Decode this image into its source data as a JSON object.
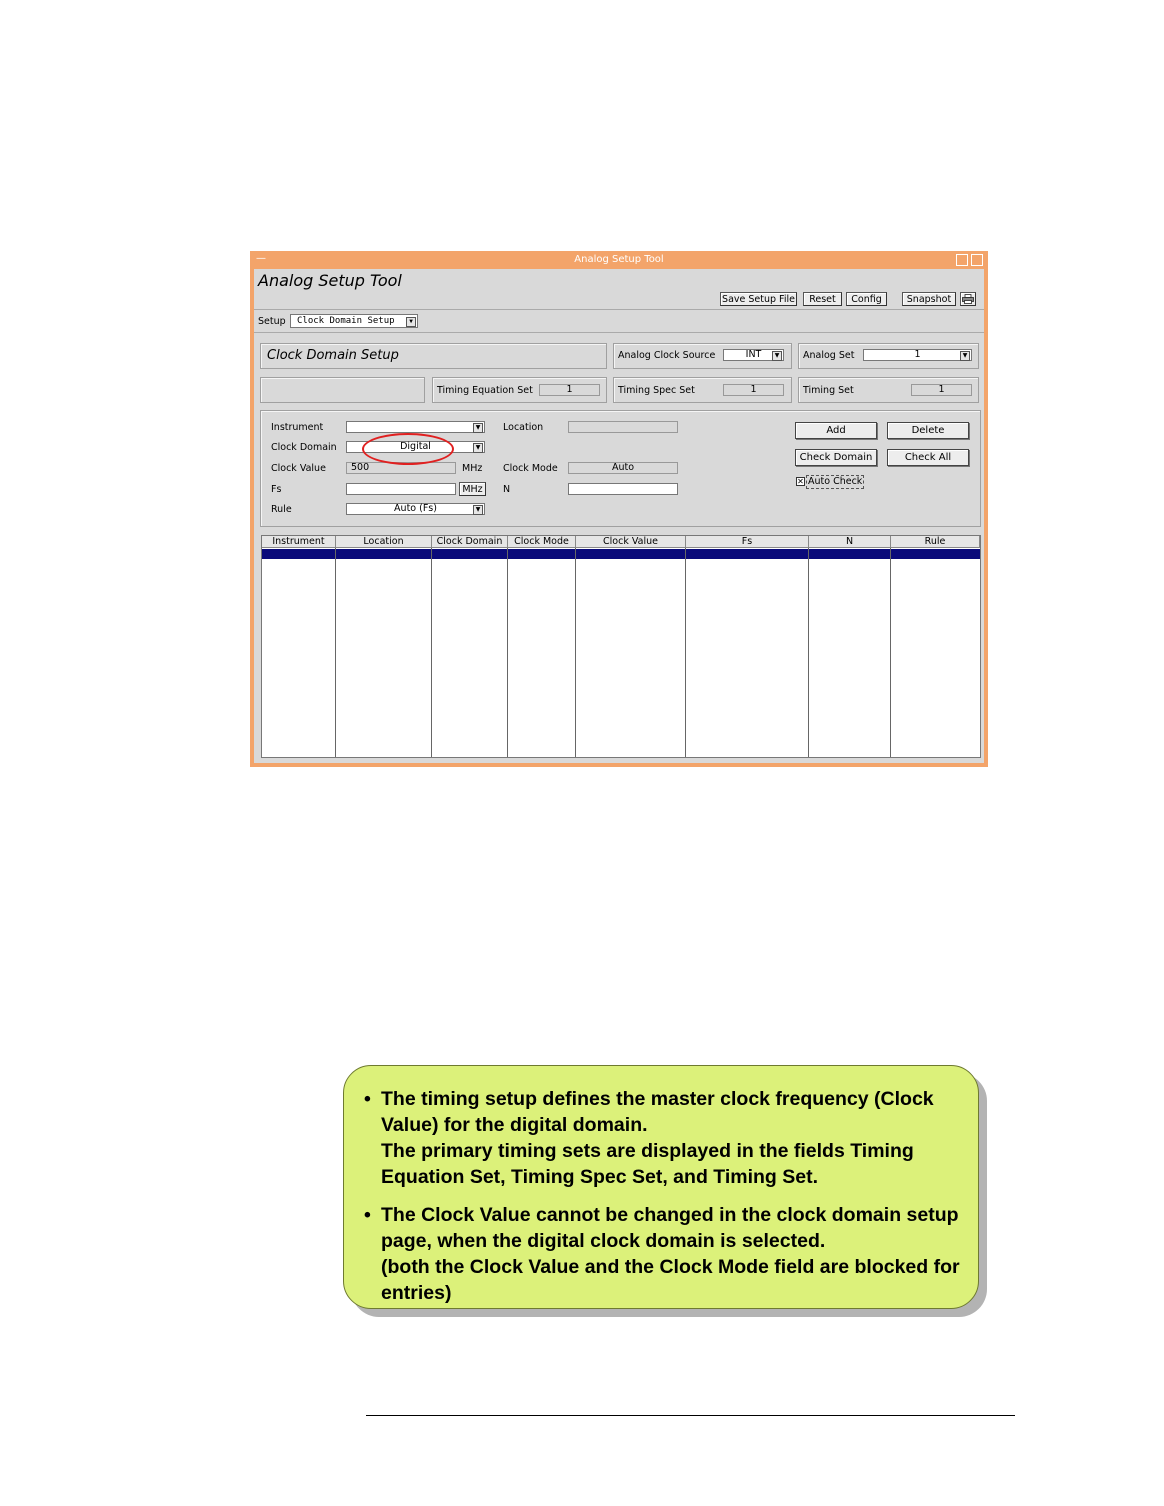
{
  "window": {
    "title": "Analog Setup Tool",
    "app_title": "Analog Setup Tool",
    "menu_glyph": "—"
  },
  "toolbar": {
    "save": "Save Setup File",
    "reset": "Reset",
    "config": "Config",
    "snapshot": "Snapshot",
    "print_icon": "printer-icon"
  },
  "setup": {
    "label": "Setup",
    "value": "Clock Domain Setup"
  },
  "header": {
    "panel_title": "Clock Domain Setup",
    "analog_clock_source_label": "Analog Clock Source",
    "analog_clock_source_value": "INT",
    "analog_set_label": "Analog Set",
    "analog_set_value": "1",
    "timing_equation_set_label": "Timing Equation Set",
    "timing_equation_set_value": "1",
    "timing_spec_set_label": "Timing Spec Set",
    "timing_spec_set_value": "1",
    "timing_set_label": "Timing Set",
    "timing_set_value": "1"
  },
  "form": {
    "instrument_label": "Instrument",
    "instrument_value": "",
    "location_label": "Location",
    "location_value": "",
    "clock_domain_label": "Clock Domain",
    "clock_domain_value": "Digital",
    "clock_value_label": "Clock Value",
    "clock_value_value": "500",
    "clock_value_unit": "MHz",
    "clock_mode_label": "Clock Mode",
    "clock_mode_value": "Auto",
    "fs_label": "Fs",
    "fs_value": "",
    "fs_unit": "MHz",
    "n_label": "N",
    "n_value": "",
    "rule_label": "Rule",
    "rule_value": "Auto (Fs)",
    "add": "Add",
    "delete": "Delete",
    "check_domain": "Check Domain",
    "check_all": "Check All",
    "auto_check": "Auto Check",
    "auto_check_mark": "✕"
  },
  "table": {
    "columns": [
      "Instrument",
      "Location",
      "Clock Domain",
      "Clock Mode",
      "Clock Value",
      "Fs",
      "N",
      "Rule"
    ]
  },
  "callout": {
    "bullet1_line1": "The timing setup defines the master clock frequency (Clock",
    "bullet1_line2": "Value) for the digital domain.",
    "bullet1_line3": "The primary timing sets are displayed in the fields Timing",
    "bullet1_line4": "Equation Set, Timing Spec Set, and Timing Set.",
    "bullet2_line1": "The Clock Value cannot be changed in the clock domain setup",
    "bullet2_line2": "page, when the digital clock domain is selected.",
    "bullet2_line3": "(both the Clock Value and the Clock Mode field are blocked for",
    "bullet2_line4": "entries)",
    "bullet_char": "•"
  },
  "colors": {
    "title_bar": "#f3a46a",
    "selection": "#0a0a7a",
    "callout": "#dcf17a",
    "highlight_oval": "#e02020"
  }
}
